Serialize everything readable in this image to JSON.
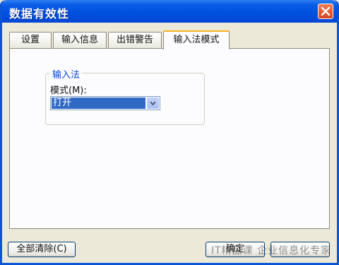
{
  "window": {
    "title": "数据有效性"
  },
  "tabs": [
    {
      "label": "设置"
    },
    {
      "label": "输入信息"
    },
    {
      "label": "出错警告"
    },
    {
      "label": "输入法模式"
    }
  ],
  "ime": {
    "group_title": "输入法",
    "mode_label": "模式(M):",
    "mode_value": "打开"
  },
  "buttons": {
    "clear_all": "全部清除(C)",
    "ok": "确定"
  },
  "watermark": "IT精品课 企业信息化专家"
}
